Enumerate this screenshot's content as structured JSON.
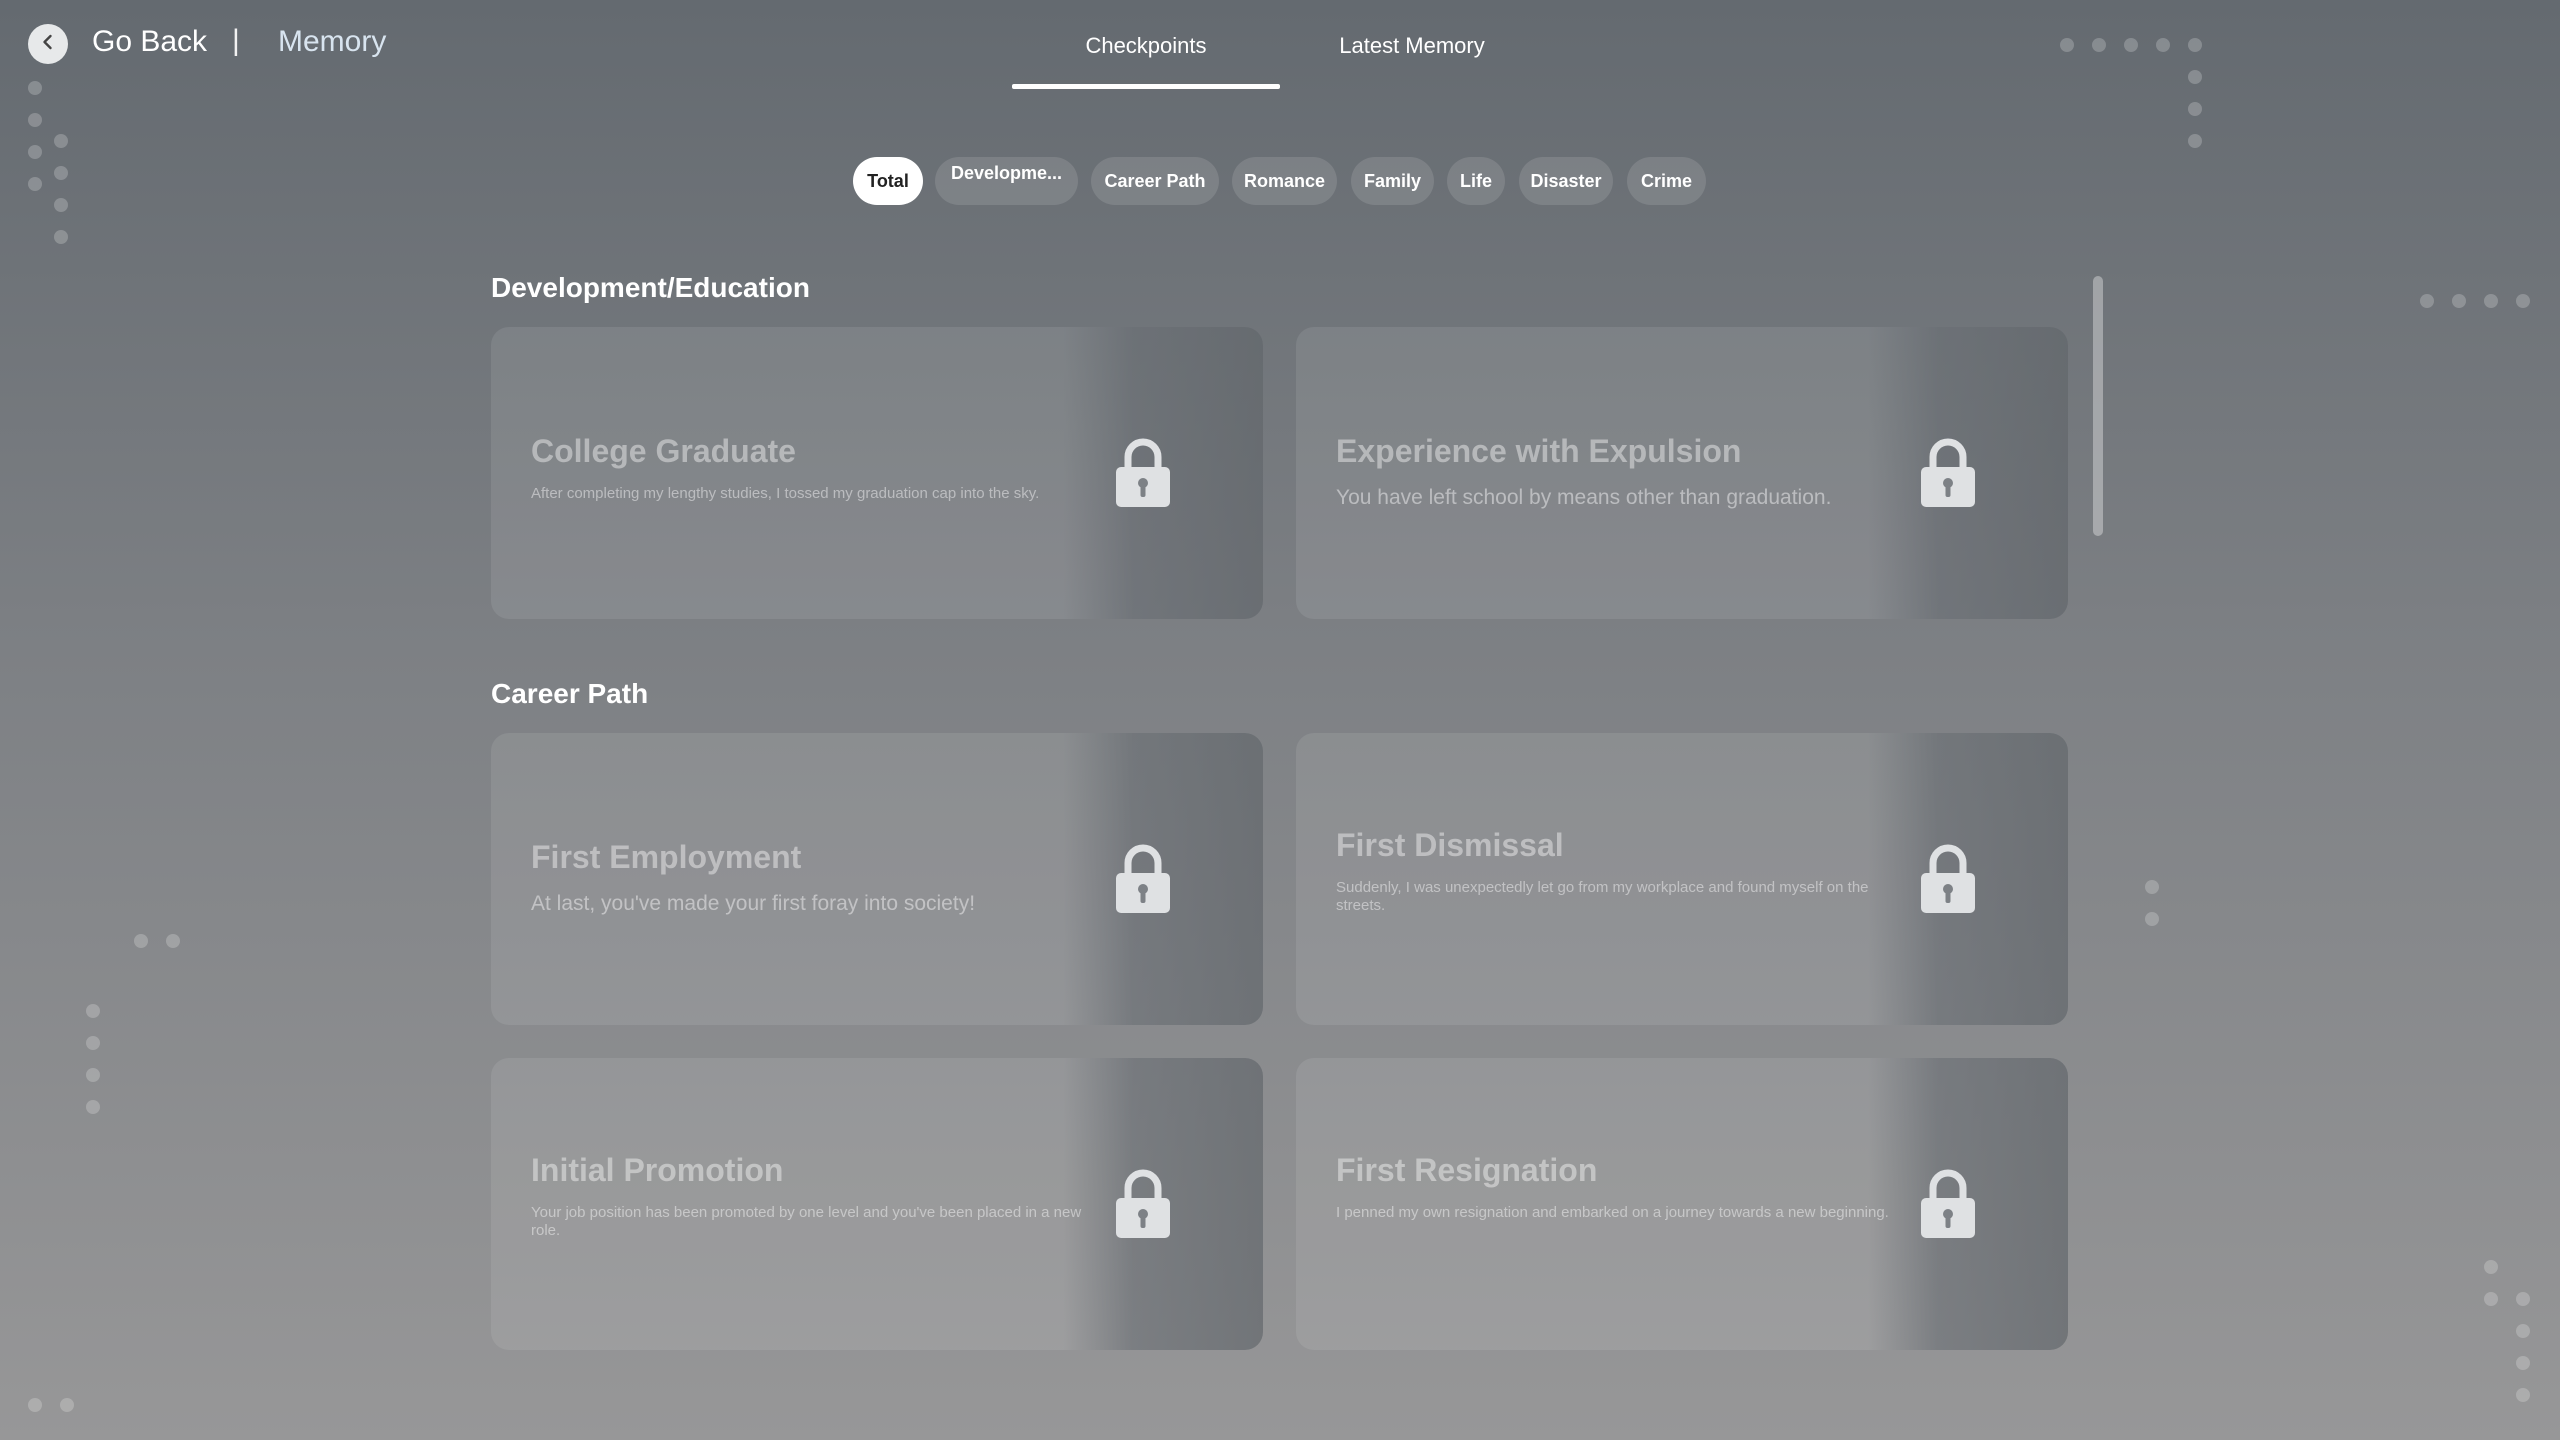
{
  "header": {
    "back_label": "Go Back",
    "separator": "|",
    "breadcrumb": "Memory",
    "tabs": [
      {
        "label": "Checkpoints",
        "active": true
      },
      {
        "label": "Latest Memory",
        "active": false
      }
    ]
  },
  "filters": [
    {
      "label": "Total",
      "active": true
    },
    {
      "label": "Developme...",
      "active": false
    },
    {
      "label": "Career Path",
      "active": false
    },
    {
      "label": "Romance",
      "active": false
    },
    {
      "label": "Family",
      "active": false
    },
    {
      "label": "Life",
      "active": false
    },
    {
      "label": "Disaster",
      "active": false
    },
    {
      "label": "Crime",
      "active": false
    }
  ],
  "sections": [
    {
      "title": "Development/Education",
      "cards": [
        {
          "title": "College Graduate",
          "description": "After completing my lengthy studies, I tossed my graduation cap into the sky.",
          "locked": true
        },
        {
          "title": "Experience with Expulsion",
          "description": "You have left school by means other than graduation.",
          "locked": true
        }
      ]
    },
    {
      "title": "Career Path",
      "cards": [
        {
          "title": "First Employment",
          "description": "At last, you've made your first foray into society!",
          "locked": true
        },
        {
          "title": "First Dismissal",
          "description": "Suddenly, I was unexpectedly let go from my workplace and found myself on the streets.",
          "locked": true
        },
        {
          "title": "Initial Promotion",
          "description": "Your job position has been promoted by one level and you've been placed in a new role.",
          "locked": true
        },
        {
          "title": "First Resignation",
          "description": "I penned my own resignation and embarked on a journey towards a new beginning.",
          "locked": true
        }
      ]
    }
  ],
  "icons": {
    "back": "chevron-left-icon",
    "lock": "lock-icon"
  },
  "colors": {
    "background": "#6e7378",
    "chip_active": "#ffffff",
    "breadcrumb": "#d8e4ef"
  }
}
